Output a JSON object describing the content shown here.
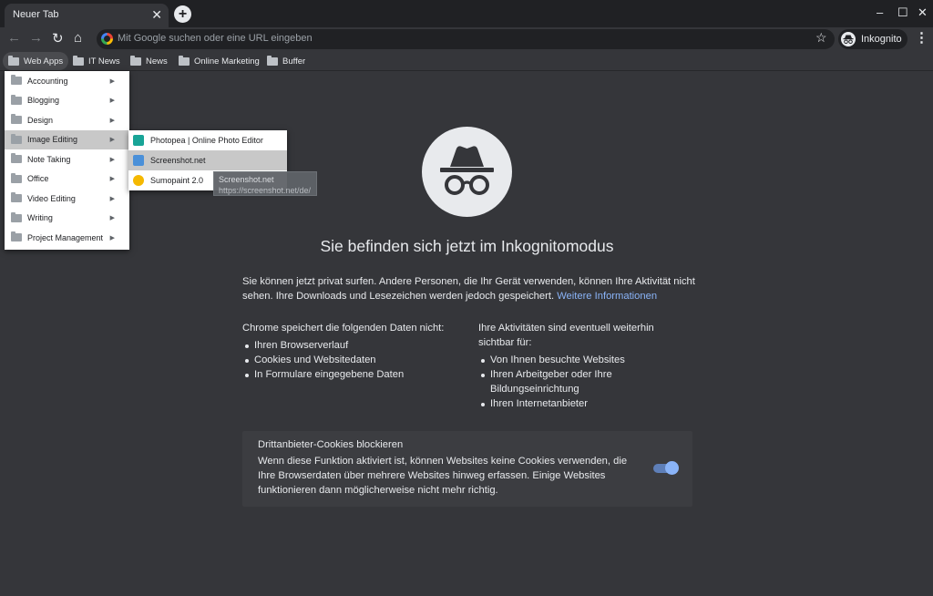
{
  "browser": {
    "tab": {
      "title": "Neuer Tab",
      "close": "✕"
    },
    "new_tab": "+",
    "window_controls": {
      "minimize": "–",
      "maximize": "☐",
      "close": "✕"
    },
    "nav": {
      "back": "←",
      "forward": "→",
      "reload": "↻",
      "home": "⌂"
    },
    "omnibox": {
      "placeholder": "Mit Google suchen oder eine URL eingeben"
    },
    "star": "☆",
    "incognito_label": "Inkognito",
    "menu": "⋮"
  },
  "bookmarks": [
    {
      "label": "Web Apps"
    },
    {
      "label": "IT News"
    },
    {
      "label": "News"
    },
    {
      "label": "Online Marketing"
    },
    {
      "label": "Buffer"
    }
  ],
  "web_apps_menu": {
    "items": [
      {
        "label": "Accounting"
      },
      {
        "label": "Blogging"
      },
      {
        "label": "Design"
      },
      {
        "label": "Image Editing"
      },
      {
        "label": "Note Taking"
      },
      {
        "label": "Office"
      },
      {
        "label": "Video Editing"
      },
      {
        "label": "Writing"
      },
      {
        "label": "Project Management"
      }
    ],
    "arrow": "▶"
  },
  "image_editing_menu": {
    "items": [
      {
        "label": "Photopea | Online Photo Editor",
        "icon": "photopea-icon",
        "color": "#18a497"
      },
      {
        "label": "Screenshot.net",
        "icon": "screenshot-net-icon",
        "color": "#4a90d9"
      },
      {
        "label": "Sumopaint 2.0",
        "icon": "sumopaint-icon",
        "color": "#f5b800"
      }
    ]
  },
  "tooltip": {
    "title": "Screenshot.net",
    "url": "https://screenshot.net/de/"
  },
  "page": {
    "headline": "Sie befinden sich jetzt im Inkognitomodus",
    "intro": "Sie können jetzt privat surfen. Andere Personen, die Ihr Gerät verwenden, können Ihre Aktivität nicht sehen. Ihre Downloads und Lesezeichen werden jedoch gespeichert.",
    "learn_more": "Weitere Informationen",
    "left_col": {
      "heading_pre": "Chrome ",
      "heading_bold": "speichert die folgenden Daten nicht:",
      "items": [
        "Ihren Browserverlauf",
        "Cookies und Websitedaten",
        "In Formulare eingegebene Daten"
      ]
    },
    "right_col": {
      "heading_bold": "Ihre Aktivitäten sind eventuell weiterhin sichtbar",
      "heading_post": " für:",
      "items": [
        "Von Ihnen besuchte Websites",
        "Ihren Arbeitgeber oder Ihre Bildungseinrichtung",
        "Ihren Internetanbieter"
      ]
    },
    "cookies": {
      "title": "Drittanbieter-Cookies blockieren",
      "text": "Wenn diese Funktion aktiviert ist, können Websites keine Cookies verwenden, die Ihre Browserdaten über mehrere Websites hinweg erfassen. Einige Websites funktionieren dann möglicherweise nicht mehr richtig.",
      "enabled": true
    }
  },
  "colors": {
    "accent": "#8ab4f8",
    "background": "#35363a",
    "frame": "#202124"
  }
}
